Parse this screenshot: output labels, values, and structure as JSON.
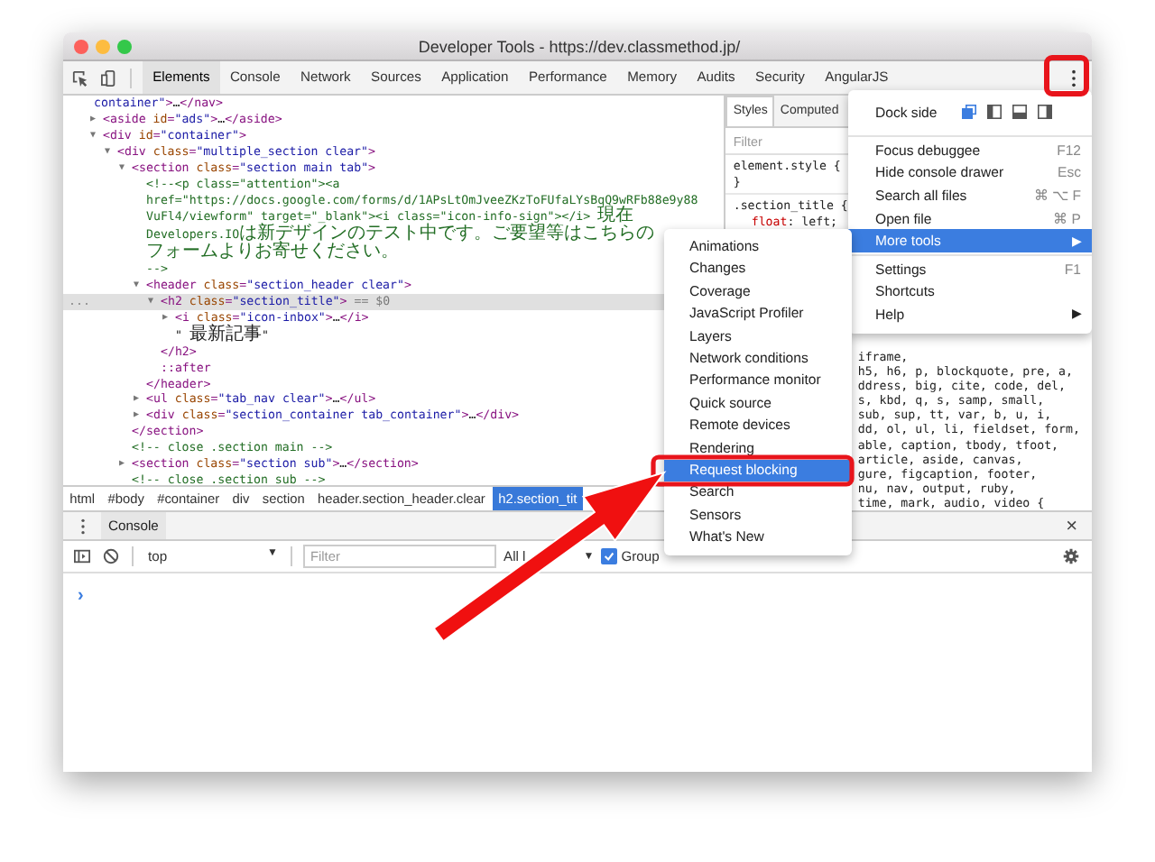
{
  "window": {
    "title": "Developer Tools - https://dev.classmethod.jp/"
  },
  "tabs": [
    {
      "label": "Elements",
      "selected": true
    },
    {
      "label": "Console",
      "selected": false
    },
    {
      "label": "Network",
      "selected": false
    },
    {
      "label": "Sources",
      "selected": false
    },
    {
      "label": "Application",
      "selected": false
    },
    {
      "label": "Performance",
      "selected": false
    },
    {
      "label": "Memory",
      "selected": false
    },
    {
      "label": "Audits",
      "selected": false
    },
    {
      "label": "Security",
      "selected": false
    },
    {
      "label": "AngularJS",
      "selected": false
    }
  ],
  "elements": {
    "fragment": [
      {
        "kind": "val",
        "text": "container\""
      },
      {
        "kind": "tag",
        "text": ">"
      },
      {
        "kind": "text",
        "text": "…"
      },
      {
        "kind": "tag",
        "text": "</nav>"
      }
    ],
    "tree": [
      {
        "toggle": "▶",
        "selected": false,
        "parts": [
          {
            "kind": "tag",
            "text": "<aside "
          },
          {
            "kind": "attr",
            "text": "id"
          },
          {
            "kind": "tag",
            "text": "="
          },
          {
            "kind": "val",
            "text": "\"ads\""
          },
          {
            "kind": "tag",
            "text": ">"
          },
          {
            "kind": "text",
            "text": "…"
          },
          {
            "kind": "tag",
            "text": "</aside>"
          }
        ]
      },
      {
        "toggle": "▼",
        "selected": false,
        "parts": [
          {
            "kind": "tag",
            "text": "<div "
          },
          {
            "kind": "attr",
            "text": "id"
          },
          {
            "kind": "tag",
            "text": "="
          },
          {
            "kind": "val",
            "text": "\"container\""
          },
          {
            "kind": "tag",
            "text": ">"
          }
        ],
        "children": [
          {
            "toggle": "▼",
            "selected": false,
            "parts": [
              {
                "kind": "tag",
                "text": "<div "
              },
              {
                "kind": "attr",
                "text": "class"
              },
              {
                "kind": "tag",
                "text": "="
              },
              {
                "kind": "val",
                "text": "\"multiple_section clear\""
              },
              {
                "kind": "tag",
                "text": ">"
              }
            ],
            "children": [
              {
                "toggle": "▼",
                "selected": false,
                "parts": [
                  {
                    "kind": "tag",
                    "text": "<section "
                  },
                  {
                    "kind": "attr",
                    "text": "class"
                  },
                  {
                    "kind": "tag",
                    "text": "="
                  },
                  {
                    "kind": "val",
                    "text": "\"section main tab\""
                  },
                  {
                    "kind": "tag",
                    "text": ">"
                  }
                ],
                "close": "</section>",
                "children": [
                  {
                    "selected": false,
                    "lines": [
                      "<!--<p class=\"attention\"><a",
                      "href=\"https://docs.google.com/forms/d/1APsLtOmJveeZKzToFUfaLYsBqQ9wRFb88e9y88",
                      "VuFl4/viewform\" target=\"_blank\"><i class=\"icon-info-sign\"></i> 現在",
                      "Developers.IOは新デザインのテスト中です。ご要望等はこちらのフォームよりお寄せください。",
                      "-->"
                    ]
                  },
                  {
                    "toggle": "▼",
                    "selected": false,
                    "parts": [
                      {
                        "kind": "tag",
                        "text": "<header "
                      },
                      {
                        "kind": "attr",
                        "text": "class"
                      },
                      {
                        "kind": "tag",
                        "text": "="
                      },
                      {
                        "kind": "val",
                        "text": "\"section_header clear\""
                      },
                      {
                        "kind": "tag",
                        "text": ">"
                      }
                    ],
                    "close": "</header>",
                    "children": [
                      {
                        "toggle": "▼",
                        "selected": true,
                        "gutter": "...",
                        "parts": [
                          {
                            "kind": "tag",
                            "text": "<h2 "
                          },
                          {
                            "kind": "attr",
                            "text": "class"
                          },
                          {
                            "kind": "tag",
                            "text": "="
                          },
                          {
                            "kind": "val",
                            "text": "\"section_title\""
                          },
                          {
                            "kind": "tag",
                            "text": ">"
                          },
                          {
                            "kind": "dim",
                            "text": " == $0"
                          }
                        ],
                        "close": "</h2>",
                        "children": [
                          {
                            "toggle": "▶",
                            "selected": false,
                            "parts": [
                              {
                                "kind": "tag",
                                "text": "<i "
                              },
                              {
                                "kind": "attr",
                                "text": "class"
                              },
                              {
                                "kind": "tag",
                                "text": "="
                              },
                              {
                                "kind": "val",
                                "text": "\"icon-inbox\""
                              },
                              {
                                "kind": "tag",
                                "text": ">"
                              },
                              {
                                "kind": "text",
                                "text": "…"
                              },
                              {
                                "kind": "tag",
                                "text": "</i>"
                              }
                            ]
                          },
                          {
                            "selected": false,
                            "parts": [
                              {
                                "kind": "text",
                                "text": "\" 最新記事\""
                              }
                            ]
                          }
                        ]
                      },
                      {
                        "selected": false,
                        "parts": [
                          {
                            "kind": "pseudo",
                            "text": "::after"
                          }
                        ]
                      }
                    ]
                  },
                  {
                    "toggle": "▶",
                    "selected": false,
                    "parts": [
                      {
                        "kind": "tag",
                        "text": "<ul "
                      },
                      {
                        "kind": "attr",
                        "text": "class"
                      },
                      {
                        "kind": "tag",
                        "text": "="
                      },
                      {
                        "kind": "val",
                        "text": "\"tab_nav clear\""
                      },
                      {
                        "kind": "tag",
                        "text": ">"
                      },
                      {
                        "kind": "text",
                        "text": "…"
                      },
                      {
                        "kind": "tag",
                        "text": "</ul>"
                      }
                    ]
                  },
                  {
                    "toggle": "▶",
                    "selected": false,
                    "parts": [
                      {
                        "kind": "tag",
                        "text": "<div "
                      },
                      {
                        "kind": "attr",
                        "text": "class"
                      },
                      {
                        "kind": "tag",
                        "text": "="
                      },
                      {
                        "kind": "val",
                        "text": "\"section_container tab_container\""
                      },
                      {
                        "kind": "tag",
                        "text": ">"
                      },
                      {
                        "kind": "text",
                        "text": "…"
                      },
                      {
                        "kind": "tag",
                        "text": "</div>"
                      }
                    ]
                  }
                ]
              },
              {
                "selected": false,
                "lines": [
                  "<!-- close .section main -->"
                ]
              },
              {
                "toggle": "▶",
                "selected": false,
                "parts": [
                  {
                    "kind": "tag",
                    "text": "<section "
                  },
                  {
                    "kind": "attr",
                    "text": "class"
                  },
                  {
                    "kind": "tag",
                    "text": "="
                  },
                  {
                    "kind": "val",
                    "text": "\"section sub\""
                  },
                  {
                    "kind": "tag",
                    "text": ">"
                  },
                  {
                    "kind": "text",
                    "text": "…"
                  },
                  {
                    "kind": "tag",
                    "text": "</section>"
                  }
                ]
              },
              {
                "selected": false,
                "lines": [
                  "<!-- close .section sub -->"
                ]
              }
            ]
          }
        ]
      }
    ]
  },
  "breadcrumb": [
    {
      "label": "html",
      "selected": false
    },
    {
      "label": "#body",
      "selected": false
    },
    {
      "label": "#container",
      "selected": false
    },
    {
      "label": "div",
      "selected": false
    },
    {
      "label": "section",
      "selected": false
    },
    {
      "label": "header.section_header.clear",
      "selected": false
    },
    {
      "label": "h2.section_tit",
      "selected": true
    }
  ],
  "styles": {
    "tabs": [
      {
        "label": "Styles",
        "selected": true
      },
      {
        "label": "Computed",
        "selected": false
      }
    ],
    "filter": {
      "placeholder": "Filter"
    },
    "rules": [
      {
        "selector": "element.style {",
        "end": "}"
      },
      {
        "selector": ".section_title {",
        "prop": "float",
        "value": ": left;"
      }
    ],
    "tail": [
      "iframe,",
      "h5, h6, p, blockquote, pre, a,",
      "ddress, big, cite, code, del,",
      "s, kbd, q, s, samp, small,",
      "sub, sup, tt, var, b, u, i,",
      "dd, ol, ul, li, fieldset, form,",
      "able, caption, tbody, tfoot,",
      "article, aside, canvas,",
      "gure, figcaption, footer,",
      "nu, nav, output, ruby,",
      "time, mark, audio, video {"
    ]
  },
  "drawer": {
    "tab": "Console",
    "close": "×",
    "context": "top",
    "caret": "▼",
    "filter": {
      "placeholder": "Filter"
    },
    "levels": "All l",
    "levels_caret": "▼",
    "group": {
      "label": "Group",
      "checked": true
    },
    "prompt": "›"
  },
  "menu": {
    "dock_label": "Dock side",
    "dock_options": [
      {
        "kind": "undock",
        "selected": true
      },
      {
        "kind": "left",
        "selected": false
      },
      {
        "kind": "bottom",
        "selected": false
      },
      {
        "kind": "right",
        "selected": false
      }
    ],
    "items": [
      {
        "kind": "separator"
      },
      {
        "kind": "item",
        "label": "Focus debuggee",
        "shortcut": "F12",
        "selected": false
      },
      {
        "kind": "item",
        "label": "Hide console drawer",
        "shortcut": "Esc",
        "selected": false
      },
      {
        "kind": "item",
        "label": "Search all files",
        "shortcut": "⌘ ⌥ F",
        "selected": false
      },
      {
        "kind": "item",
        "label": "Open file",
        "shortcut": "⌘ P",
        "selected": false
      },
      {
        "kind": "item",
        "label": "More tools",
        "submenu": "▶",
        "selected": true
      },
      {
        "kind": "separator"
      },
      {
        "kind": "item",
        "label": "Settings",
        "shortcut": "F1",
        "selected": false
      },
      {
        "kind": "item",
        "label": "Shortcuts",
        "selected": false
      },
      {
        "kind": "item",
        "label": "Help",
        "submenu": "▶",
        "selected": false
      }
    ]
  },
  "submenu": [
    {
      "label": "Animations",
      "selected": false
    },
    {
      "label": "Changes",
      "selected": false
    },
    {
      "label": "Coverage",
      "selected": false
    },
    {
      "label": "JavaScript Profiler",
      "selected": false
    },
    {
      "label": "Layers",
      "selected": false
    },
    {
      "label": "Network conditions",
      "selected": false
    },
    {
      "label": "Performance monitor",
      "selected": false
    },
    {
      "label": "Quick source",
      "selected": false
    },
    {
      "label": "Remote devices",
      "selected": false
    },
    {
      "label": "Rendering",
      "selected": false
    },
    {
      "label": "Request blocking",
      "selected": true
    },
    {
      "label": "Search",
      "selected": false
    },
    {
      "label": "Sensors",
      "selected": false
    },
    {
      "label": "What's New",
      "selected": false
    }
  ]
}
